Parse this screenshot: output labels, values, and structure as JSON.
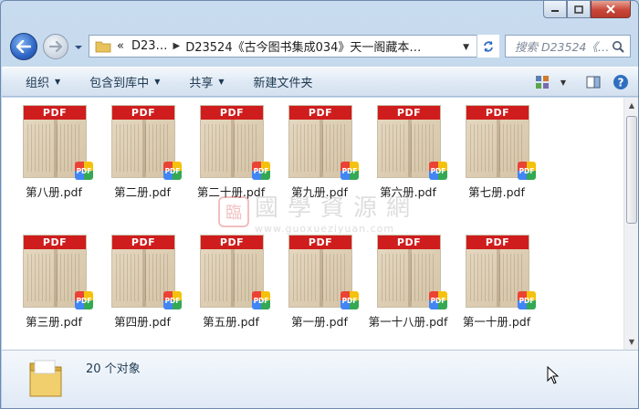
{
  "window": {
    "caption": {
      "minimize": "min",
      "maximize": "max",
      "close": "close"
    }
  },
  "address": {
    "breadcrumb_prefix": "«",
    "crumbs": [
      "D23…",
      "D23524《古今图书集成034》天一阁藏本…"
    ],
    "search_placeholder": "搜索 D23524《…"
  },
  "toolbar": {
    "organize": "组织",
    "include_in_library": "包含到库中",
    "share": "共享",
    "new_folder": "新建文件夹"
  },
  "files": [
    {
      "name": "第八册.pdf",
      "badge": "PDF",
      "banner": "PDF"
    },
    {
      "name": "第二册.pdf",
      "badge": "PDF",
      "banner": "PDF"
    },
    {
      "name": "第二十册.pdf",
      "badge": "PDF",
      "banner": "PDF"
    },
    {
      "name": "第九册.pdf",
      "badge": "PDF",
      "banner": "PDF"
    },
    {
      "name": "第六册.pdf",
      "badge": "PDF",
      "banner": "PDF"
    },
    {
      "name": "第七册.pdf",
      "badge": "PDF",
      "banner": "PDF"
    },
    {
      "name": "第三册.pdf",
      "badge": "PDF",
      "banner": "PDF"
    },
    {
      "name": "第四册.pdf",
      "badge": "PDF",
      "banner": "PDF"
    },
    {
      "name": "第五册.pdf",
      "badge": "PDF",
      "banner": "PDF"
    },
    {
      "name": "第一册.pdf",
      "badge": "PDF",
      "banner": "PDF"
    },
    {
      "name": "第一十八册.pdf",
      "badge": "PDF",
      "banner": "PDF"
    },
    {
      "name": "第一十册.pdf",
      "badge": "PDF",
      "banner": "PDF"
    }
  ],
  "watermark": {
    "seal": "臨",
    "title": "國學資源網",
    "url": "www.guoxueziyuan.com"
  },
  "status": {
    "count": "20 个对象"
  },
  "colors": {
    "pdf_banner": "#cf1d1d",
    "window_frame": "#b6cde6",
    "toolbar": "#dfe9f5"
  }
}
